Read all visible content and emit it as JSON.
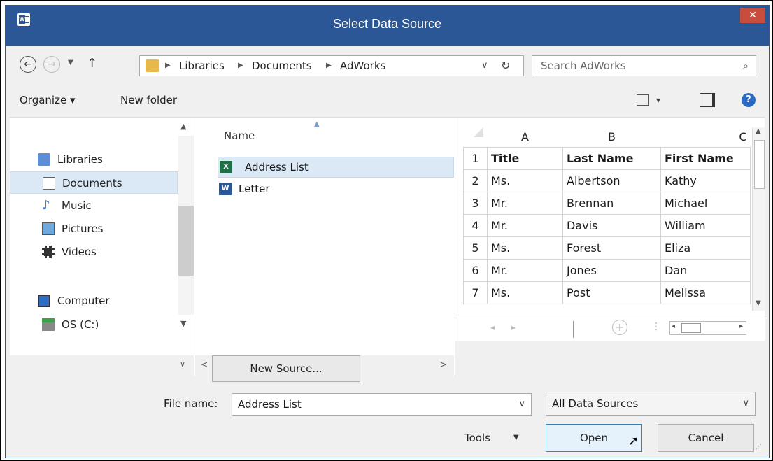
{
  "window": {
    "title": "Select Data Source",
    "close_glyph": "✕"
  },
  "nav": {
    "back_icon": "back-arrow-icon",
    "forward_icon": "forward-arrow-icon",
    "up_icon": "up-arrow-icon"
  },
  "address": {
    "crumbs": [
      "Libraries",
      "Documents",
      "AdWorks"
    ],
    "dropdown_glyph": "∨",
    "refresh_glyph": "↻"
  },
  "search": {
    "placeholder": "Search AdWorks"
  },
  "toolbar": {
    "organize": "Organize ▾",
    "new_folder": "New folder",
    "view_glyph": "▾",
    "help_glyph": "?"
  },
  "sidebar": {
    "items": [
      {
        "label": "Libraries",
        "icon": "libraries-icon"
      },
      {
        "label": "Documents",
        "icon": "documents-icon",
        "selected": true
      },
      {
        "label": "Music",
        "icon": "music-icon"
      },
      {
        "label": "Pictures",
        "icon": "pictures-icon"
      },
      {
        "label": "Videos",
        "icon": "videos-icon"
      },
      {
        "label": "Computer",
        "icon": "computer-icon"
      },
      {
        "label": "OS (C:)",
        "icon": "drive-icon"
      }
    ]
  },
  "files": {
    "column_header": "Name",
    "items": [
      {
        "label": "Address List",
        "icon": "excel-file-icon",
        "selected": true
      },
      {
        "label": "Letter",
        "icon": "word-file-icon"
      }
    ]
  },
  "preview": {
    "columns": [
      "A",
      "B",
      "C"
    ],
    "rows": [
      {
        "n": "1",
        "a": "Title",
        "b": "Last Name",
        "c": "First Name"
      },
      {
        "n": "2",
        "a": "Ms.",
        "b": "Albertson",
        "c": "Kathy"
      },
      {
        "n": "3",
        "a": "Mr.",
        "b": "Brennan",
        "c": "Michael"
      },
      {
        "n": "4",
        "a": "Mr.",
        "b": "Davis",
        "c": "William"
      },
      {
        "n": "5",
        "a": "Ms.",
        "b": "Forest",
        "c": "Eliza"
      },
      {
        "n": "6",
        "a": "Mr.",
        "b": "Jones",
        "c": "Dan"
      },
      {
        "n": "7",
        "a": "Ms.",
        "b": "Post",
        "c": "Melissa"
      }
    ]
  },
  "bottom": {
    "new_source": "New Source...",
    "file_name_label": "File name:",
    "file_name_value": "Address List",
    "filter_value": "All Data Sources",
    "tools": "Tools",
    "open": "Open",
    "cancel": "Cancel"
  }
}
